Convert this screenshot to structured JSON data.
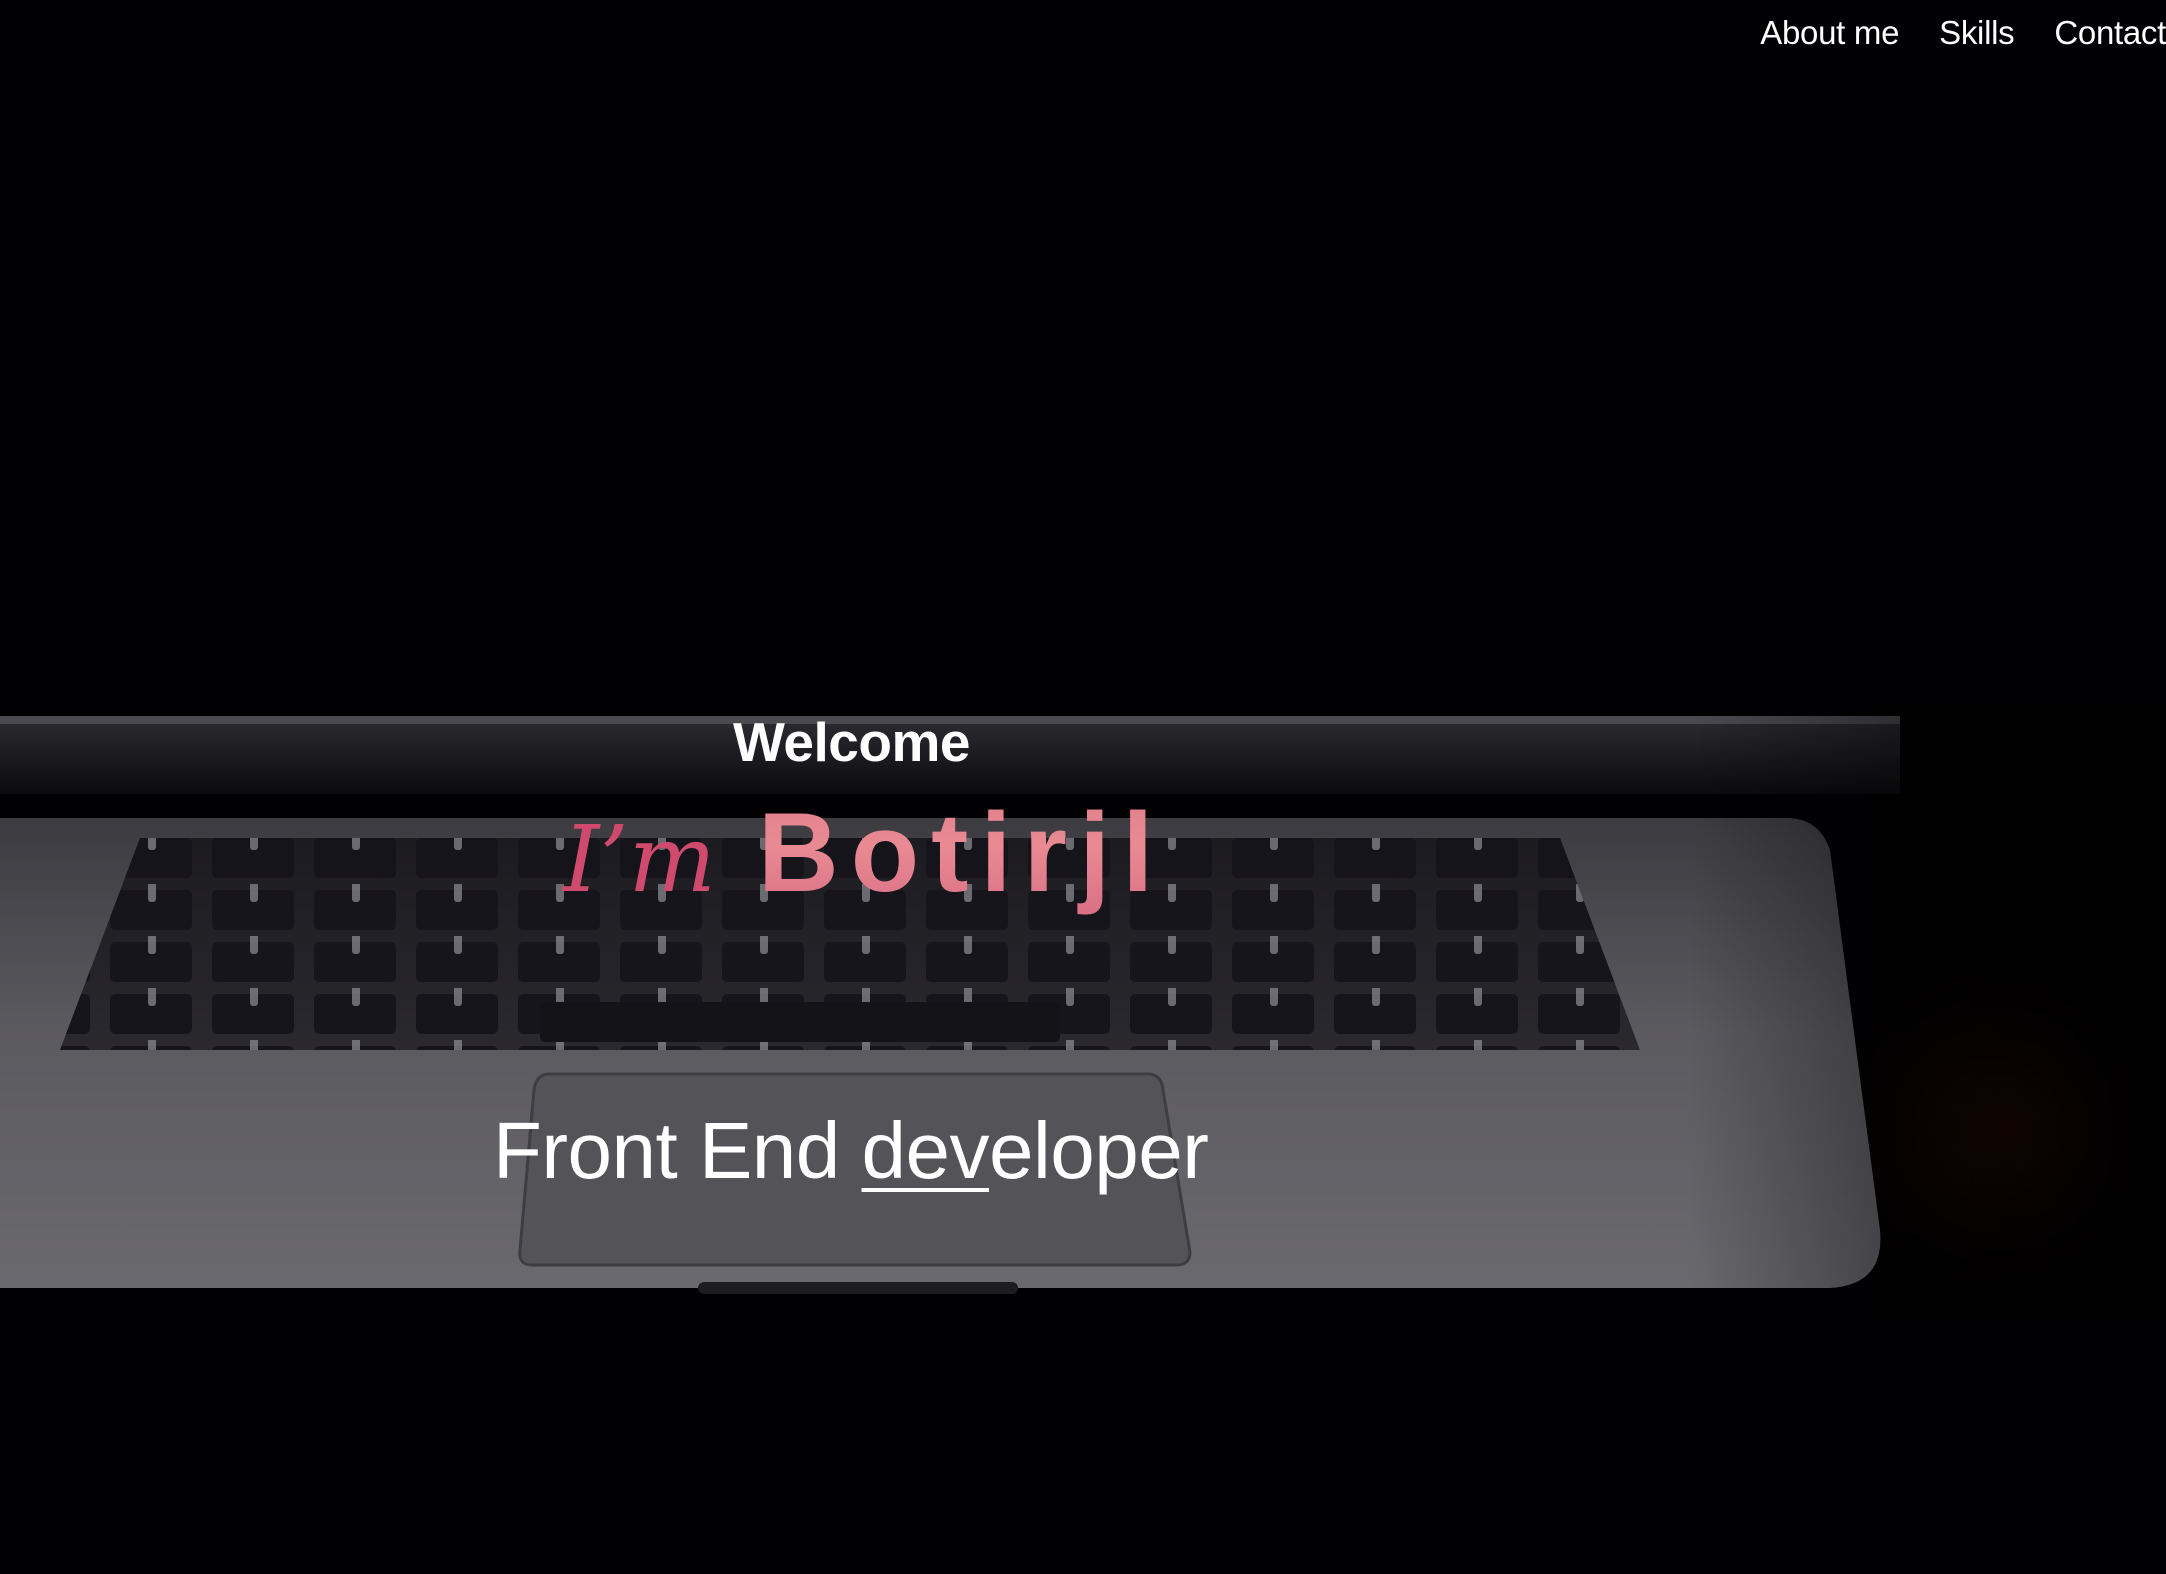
{
  "nav": {
    "items": [
      {
        "label": "About me"
      },
      {
        "label": "Skills"
      },
      {
        "label": "Contact"
      }
    ]
  },
  "hero": {
    "welcome": "Welcome",
    "im_label": "I’m",
    "name": "Botirjl",
    "role_prefix": "Front End ",
    "role_underlined": "dev",
    "role_suffix": "eloper"
  },
  "colors": {
    "background": "#000000",
    "text": "#ffffff",
    "accent_pink": "#d04a6e",
    "name_salmon": "#e98a93"
  }
}
